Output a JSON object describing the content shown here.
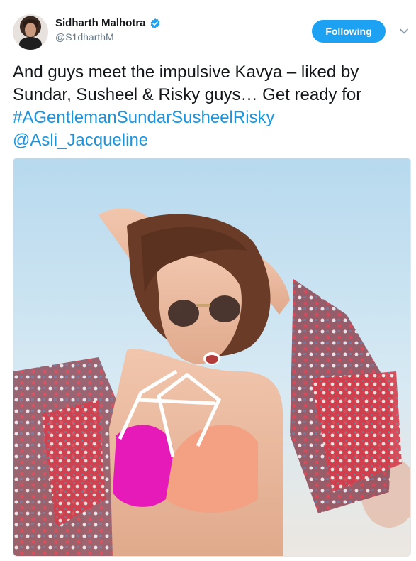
{
  "user": {
    "display_name": "Sidharth Malhotra",
    "handle": "@S1dharthM",
    "verified": true
  },
  "follow_button": {
    "label": "Following",
    "color": "#1da1f2"
  },
  "tweet": {
    "text_plain": "And guys meet the impulsive Kavya – liked by Sundar, Susheel & Risky guys… Get ready for ",
    "hashtag": "#AGentlemanSundarSusheelRisky",
    "mention": "@Asli_Jacqueline",
    "link_color": "#1b95e0"
  },
  "media": {
    "icon": "photo-image"
  },
  "icons": {
    "verified": "verified-badge-icon",
    "menu": "chevron-down-icon"
  }
}
